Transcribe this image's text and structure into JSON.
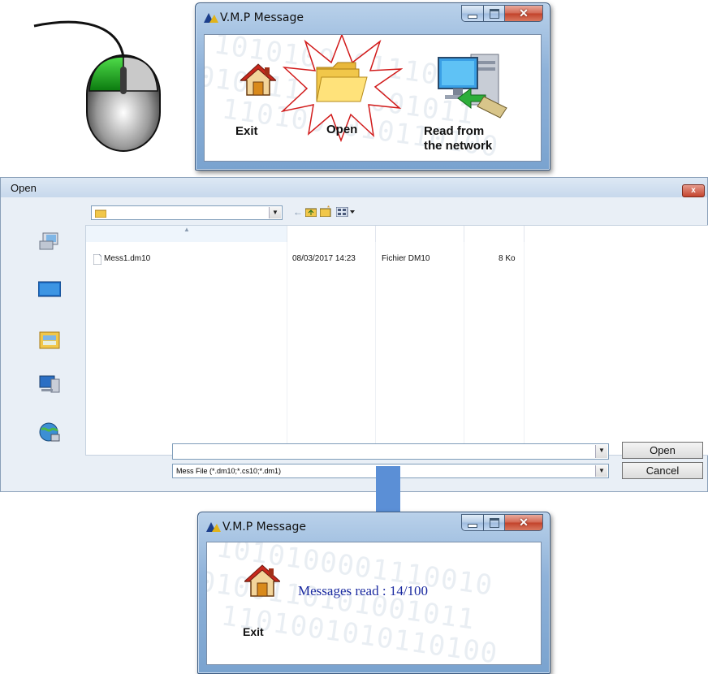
{
  "top_window": {
    "title": "V.M.P Message",
    "exit_label": "Exit",
    "open_label": "Open",
    "network_label_line1": "Read from",
    "network_label_line2": "the network"
  },
  "open_dialog": {
    "title": "Open",
    "files": [
      {
        "name": "Mess1.dm10",
        "modified": "08/03/2017 14:23",
        "type": "Fichier DM10",
        "size": "8 Ko"
      }
    ],
    "filename_value": "",
    "filter_value": "Mess File (*.dm10;*.cs10;*.dm1)",
    "open_button": "Open",
    "cancel_button": "Cancel",
    "close_glyph": "x"
  },
  "bottom_window": {
    "title": "V.M.P Message",
    "exit_label": "Exit",
    "status_text": "Messages read : 14/100"
  },
  "colors": {
    "arrow": "#5b8fd6",
    "mouse_left_button": "#17a31a",
    "status_text": "#1a2aa0",
    "burst_outline": "#d11a1a"
  },
  "icons": [
    "mouse-icon",
    "home-icon",
    "folder-icon",
    "network-computer-icon",
    "recent-places-icon",
    "desktop-icon",
    "libraries-icon",
    "computer-icon",
    "network-icon",
    "down-arrow-icon"
  ]
}
